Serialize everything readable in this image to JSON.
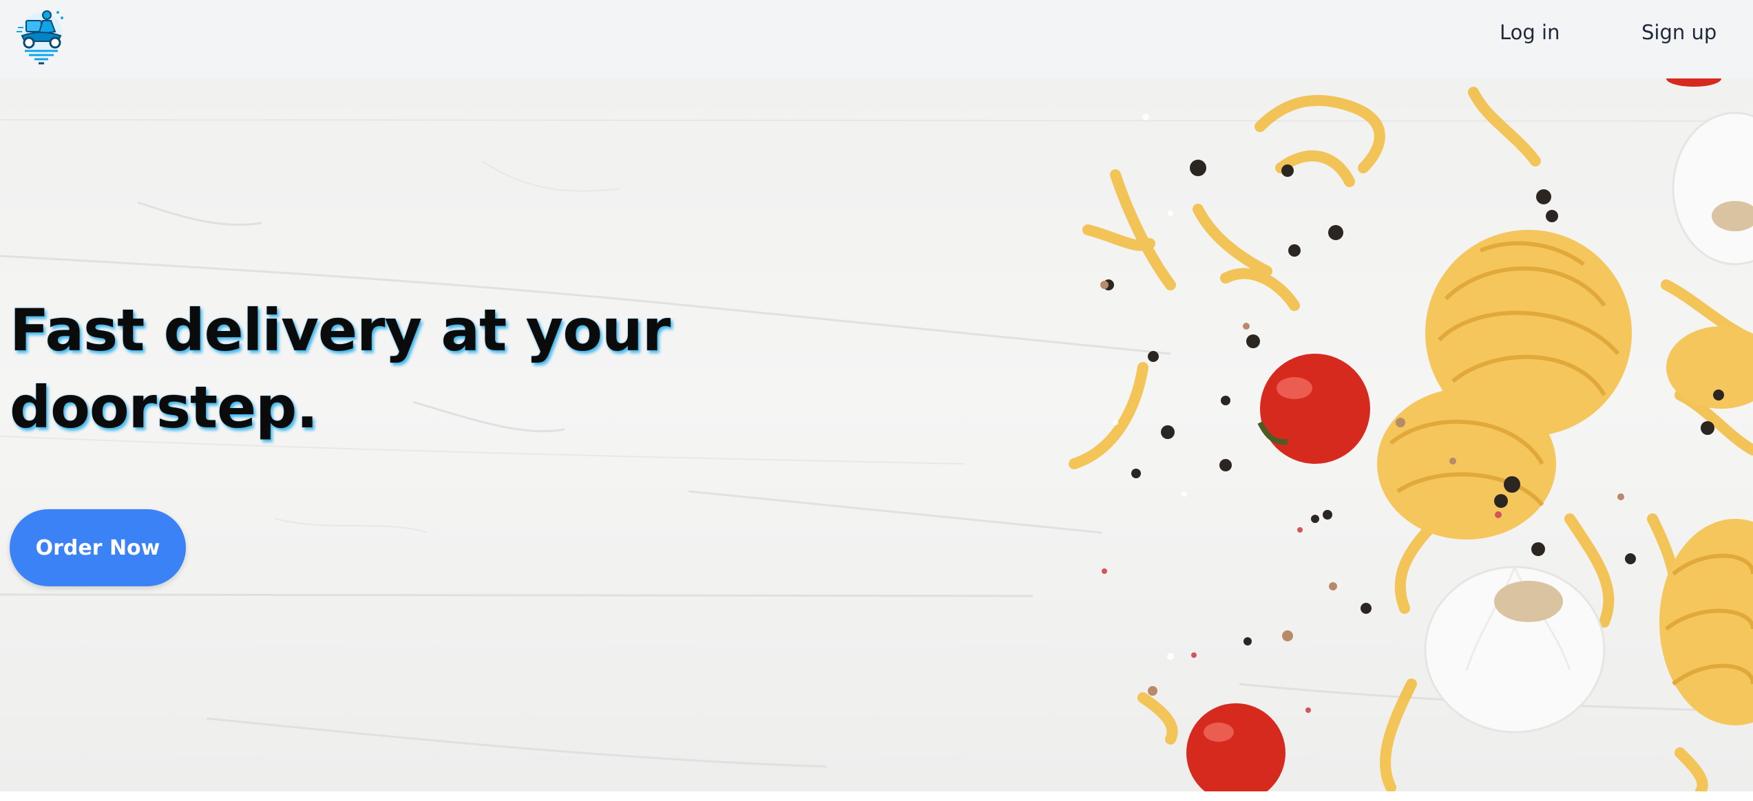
{
  "navbar": {
    "logo_icon": "delivery-scooter-logo",
    "login_label": "Log in",
    "signup_label": "Sign up"
  },
  "hero": {
    "headline": "Fast delivery at your doorstep.",
    "cta_label": "Order Now",
    "background": "pasta-tomatoes-garlic-on-white-wood"
  },
  "colors": {
    "navbar_bg": "#f3f4f6",
    "accent": "#3b82f6",
    "headline_glow": "#0ea5e9",
    "headline_text": "#0b0b0b"
  }
}
